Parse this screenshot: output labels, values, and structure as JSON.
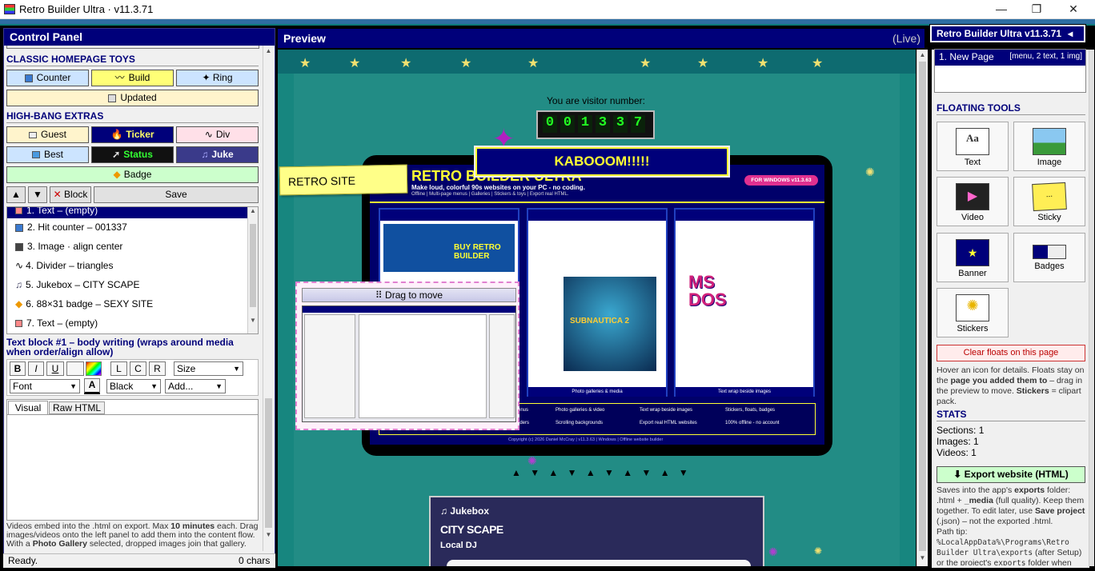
{
  "window": {
    "title": "Retro Builder Ultra  ·  v11.3.71",
    "min": "—",
    "max": "❐",
    "close": "✕"
  },
  "left": {
    "title": "Control Panel",
    "sections": {
      "classic": "CLASSIC HOMEPAGE TOYS",
      "extras": "HIGH-BANG EXTRAS"
    },
    "toys": [
      {
        "label": "Counter",
        "bg": "#cce4ff"
      },
      {
        "label": "Build",
        "bg": "#ffff77"
      },
      {
        "label": "✦ Ring",
        "bg": "#cce4ff"
      }
    ],
    "updated": "Updated",
    "extras_row1": [
      {
        "label": "Guest",
        "bg": "#fff4cc",
        "color": "#000"
      },
      {
        "label": "Ticker",
        "bg": "#00007a",
        "color": "#ffff66"
      },
      {
        "label": "Div",
        "bg": "#ffe0e8",
        "color": "#000"
      }
    ],
    "extras_row2": [
      {
        "label": "Best",
        "bg": "#cce4ff",
        "color": "#000"
      },
      {
        "label": "Status",
        "bg": "#111",
        "color": "#33ff33"
      },
      {
        "label": "Juke",
        "bg": "#3a3a8a",
        "color": "#fff"
      }
    ],
    "badge": "Badge",
    "nav": {
      "up": "▲",
      "down": "▼",
      "block": "Block",
      "block_icon": "✕",
      "save": "Save"
    },
    "items": [
      "1. Text – (empty)",
      "2. Hit counter – 001337",
      "3. Image · align center",
      "4. Divider – triangles",
      "5. Jukebox – CITY SCAPE",
      "6. 88×31 badge – SEXY SITE",
      "7. Text – (empty)"
    ],
    "textblock": "Text block #1 – body writing (wraps around media when order/align allow)",
    "fmt": {
      "b": "B",
      "i": "I",
      "u": "U",
      "l": "L",
      "c": "C",
      "r": "R",
      "size": "Size",
      "font": "Font",
      "a": "A",
      "color": "Black",
      "add": "Add..."
    },
    "tabs": [
      "Visual",
      "Raw HTML"
    ],
    "note_a": "Videos embed into the .html on export. Max ",
    "note_b": "10 minutes",
    "note_c": " each. Drag images/videos onto the left panel to add them into the content flow. With a ",
    "note_d": "Photo Gallery",
    "note_e": " selected, dropped images join that gallery.",
    "status": "Ready.",
    "chars": "0 chars"
  },
  "preview": {
    "title": "Preview",
    "live": "(Live)",
    "visitor_label": "You are visitor number:",
    "counter": [
      "0",
      "0",
      "1",
      "3",
      "3",
      "7"
    ],
    "kaboom": "KABOOOM!!!!!",
    "retro_site": "RETRO SITE",
    "banner_title": "RETRO BUILDER ULTRA",
    "banner_sub": "Make loud, colorful 90s websites on your PC - no coding.",
    "banner_sub2": "Offline | Multi-page menus | Galleries | Stickers & toys | Export real HTML.",
    "for_windows": "FOR WINDOWS  v11.3.63",
    "shot_caps": [
      "",
      "Photo galleries & media",
      "Text wrap beside images"
    ],
    "game_title": "SUBNAUTICA 2",
    "ms_dos": "MS DOS",
    "features": [
      "menus",
      "Photo galleries & video",
      "Text wrap beside images",
      "Stickers, floats, badges",
      "aders",
      "Scrolling backgrounds",
      "Export real HTML websites",
      "100% offline - no account"
    ],
    "copyright": "Copyright (c) 2026 Daniel McCray  |  v11.3.63  |  Windows  |  Offline website builder",
    "drag": "⠿ Drag to move",
    "triangles": "▲ ▼ ▲ ▼ ▲ ▼ ▲ ▼ ▲ ▼",
    "jukebox": {
      "label": "♫ Jukebox",
      "track": "CITY SCAPE",
      "sub": "Local DJ"
    }
  },
  "right": {
    "brand": "Retro Builder Ultra v11.3.71",
    "page": "1. New Page",
    "page_meta": "[menu, 2 text, 1 img]",
    "floating": "FLOATING TOOLS",
    "tools": [
      "Text",
      "Image",
      "Video",
      "Sticky",
      "Banner",
      "Badges",
      "Stickers"
    ],
    "clear": "Clear floats on this page",
    "hover_a": "Hover an icon for details. Floats stay on the ",
    "hover_b": "page you added them to",
    "hover_c": " – drag in the preview to move. ",
    "hover_d": "Stickers",
    "hover_e": " = clipart pack.",
    "stats": "STATS",
    "sections": "Sections: 1",
    "images": "Images: 1",
    "videos": "Videos: 1",
    "export": "⬇ Export website (HTML)",
    "saves_a": "Saves into the app's ",
    "saves_b": "exports",
    "saves_c": " folder: .html + ",
    "saves_d": "_media",
    "saves_e": " (full quality). Keep them together. To edit later, use ",
    "saves_f": "Save project",
    "saves_g": " (.json) – not the exported .html.",
    "path_tip": "Path tip:",
    "path": "%LocalAppData%\\Programs\\Retro Builder Ultra\\exports",
    "path_after": " (after Setup) or the project's ",
    "path_code": "exports",
    "path_end": " folder when running"
  },
  "colors": {
    "navy": "#00007a",
    "teal": "#17867f",
    "accent": "#2e6ea3"
  }
}
